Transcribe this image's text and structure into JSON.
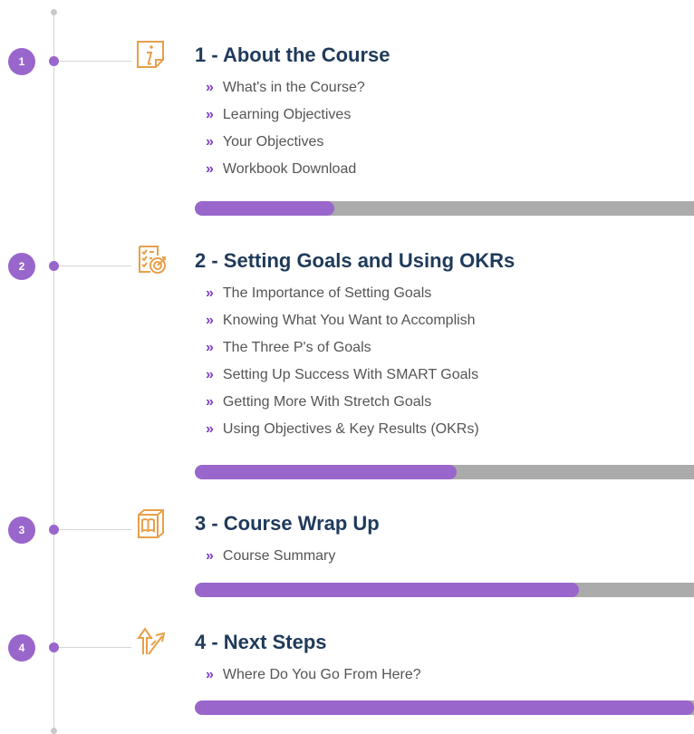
{
  "colors": {
    "accent": "#9966cc",
    "chevron": "#7d3fc4",
    "title": "#1f3a5a",
    "icon": "#e8a04a",
    "track": "#ababab",
    "line": "#d3d3d3"
  },
  "modules": [
    {
      "number": "1",
      "icon": "info-icon",
      "title": "1 - About the Course",
      "lessons": [
        "What's in the Course?",
        "Learning Objectives",
        "Your Objectives",
        "Workbook Download"
      ],
      "progress_fraction": 0.28
    },
    {
      "number": "2",
      "icon": "goals-checklist-icon",
      "title": "2 - Setting Goals and Using OKRs",
      "lessons": [
        "The Importance of Setting Goals",
        "Knowing What You Want to Accomplish",
        "The Three P's of Goals",
        "Setting Up Success With SMART Goals",
        "Getting More With Stretch Goals",
        "Using Objectives & Key Results (OKRs)"
      ],
      "progress_fraction": 0.525
    },
    {
      "number": "3",
      "icon": "book-box-icon",
      "title": "3 - Course Wrap Up",
      "lessons": [
        "Course Summary"
      ],
      "progress_fraction": 0.77
    },
    {
      "number": "4",
      "icon": "next-steps-arrows-icon",
      "title": "4 - Next Steps",
      "lessons": [
        "Where Do You Go From Here?"
      ],
      "progress_fraction": 1.0
    }
  ],
  "chevron_glyph": "»"
}
